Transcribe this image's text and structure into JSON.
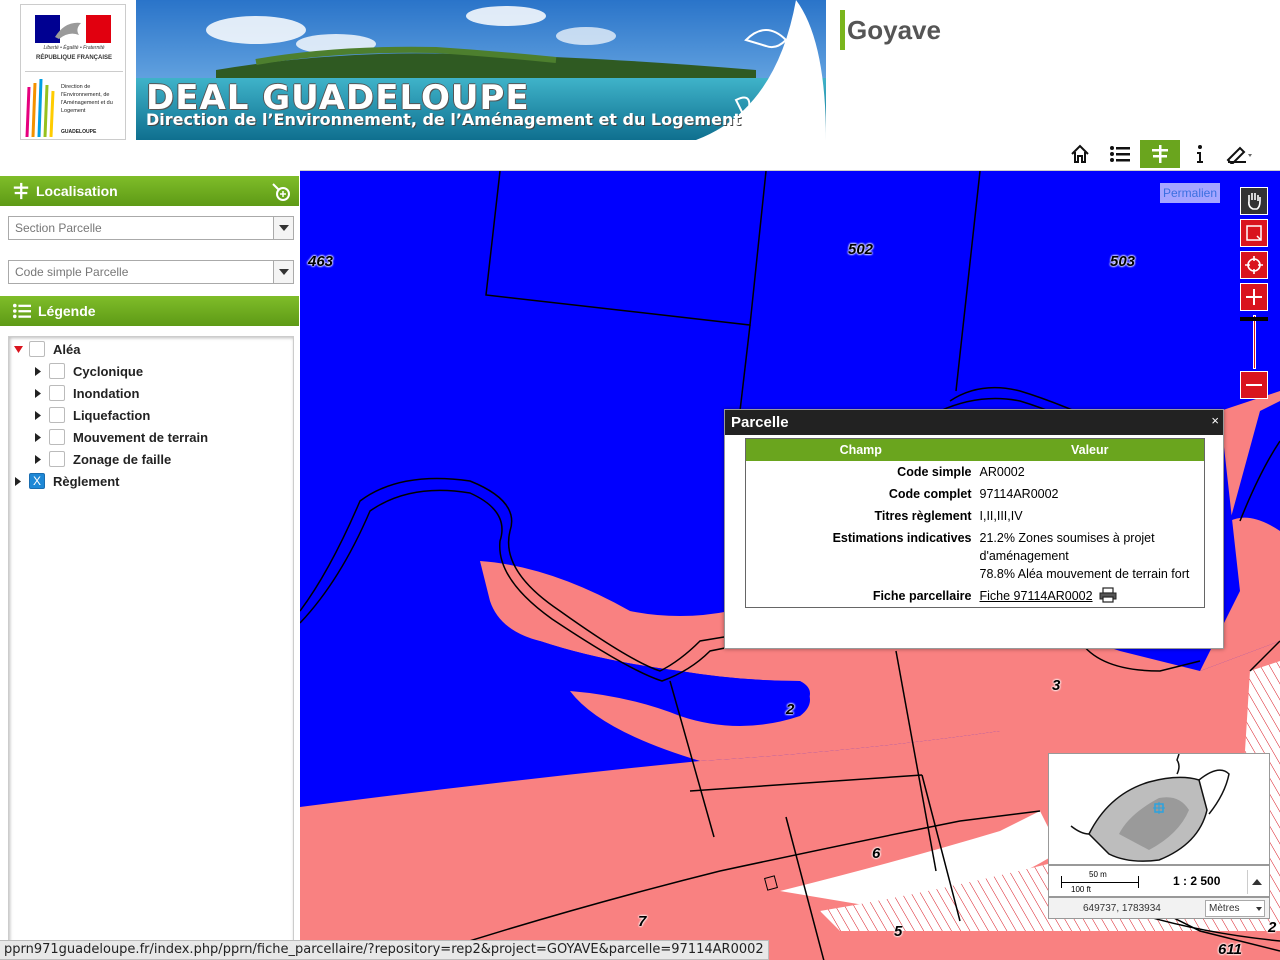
{
  "header": {
    "logo": {
      "motto": "Liberté • Égalité • Fraternité",
      "republic": "RÉPUBLIQUE FRANÇAISE",
      "direction": "Direction de l'Environnement, de l'Aménagement et du Logement",
      "region": "GUADELOUPE"
    },
    "banner": {
      "title": "DEAL GUADELOUPE",
      "subtitle": "Direction de l’Environnement, de l’Aménagement et du Logement"
    },
    "project_title": "Goyave",
    "toolbar": [
      {
        "icon": "home-icon",
        "active": false
      },
      {
        "icon": "legend-list-icon",
        "active": false
      },
      {
        "icon": "localisation-icon",
        "active": true
      },
      {
        "icon": "info-icon",
        "active": false
      },
      {
        "icon": "measure-icon",
        "active": false
      }
    ]
  },
  "panel": {
    "localisation": {
      "title": "Localisation",
      "section_placeholder": "Section Parcelle",
      "code_placeholder": "Code simple Parcelle"
    },
    "legend": {
      "title": "Légende",
      "items": [
        {
          "label": "Aléa",
          "checked": false,
          "expanded": true,
          "level": 0
        },
        {
          "label": "Cyclonique",
          "checked": false,
          "expanded": false,
          "level": 1
        },
        {
          "label": "Inondation",
          "checked": false,
          "expanded": false,
          "level": 1
        },
        {
          "label": "Liquefaction",
          "checked": false,
          "expanded": false,
          "level": 1
        },
        {
          "label": "Mouvement de terrain",
          "checked": false,
          "expanded": false,
          "level": 1
        },
        {
          "label": "Zonage de faille",
          "checked": false,
          "expanded": false,
          "level": 1
        },
        {
          "label": "Règlement",
          "checked": true,
          "expanded": false,
          "level": 0
        }
      ],
      "checked_mark": "X"
    }
  },
  "map": {
    "permalink": "Permalien",
    "parcel_labels": [
      "463",
      "502",
      "503",
      "2",
      "3",
      "6",
      "7",
      "5",
      "611",
      "2"
    ],
    "colors": {
      "zone_blue": "#0000ff",
      "zone_red": "#f98181",
      "zone_white": "#ffffff",
      "accent_green": "#6aa51e",
      "nav_red": "#d9141e"
    },
    "popup": {
      "title": "Parcelle",
      "close": "×",
      "col_field": "Champ",
      "col_value": "Valeur",
      "rows": [
        {
          "field": "Code simple",
          "value": "AR0002"
        },
        {
          "field": "Code complet",
          "value": "97114AR0002"
        },
        {
          "field": "Titres règlement",
          "value": "I,II,III,IV"
        },
        {
          "field": "Estimations indicatives",
          "value": "21.2% Zones soumises à projet d'aménagement",
          "value2": "78.8% Aléa mouvement de terrain fort"
        },
        {
          "field": "Fiche parcellaire",
          "value": "Fiche 97114AR0002",
          "link": true
        }
      ]
    },
    "scale": {
      "metric": "50 m",
      "imperial": "100 ft",
      "ratio": "1 : 2 500"
    },
    "coordinates": "649737, 1783934",
    "units": "Mètres"
  },
  "status_url": "pprn971guadeloupe.fr/index.php/pprn/fiche_parcellaire/?repository=rep2&project=GOYAVE&parcelle=97114AR0002"
}
